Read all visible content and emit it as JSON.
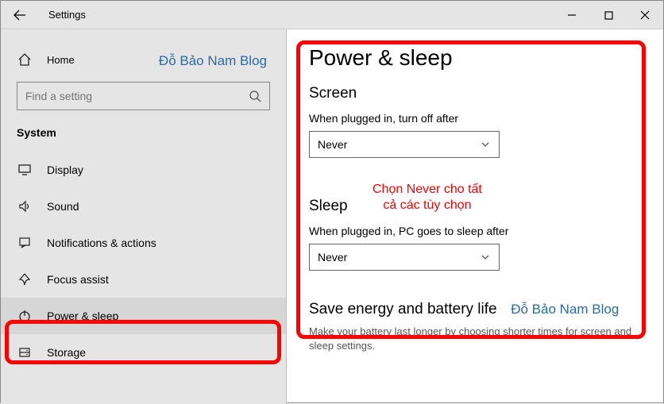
{
  "window": {
    "title": "Settings"
  },
  "brand": "Đỗ Bảo Nam Blog",
  "sidebar": {
    "home_label": "Home",
    "search_placeholder": "Find a setting",
    "section_label": "System",
    "items": [
      {
        "label": "Display"
      },
      {
        "label": "Sound"
      },
      {
        "label": "Notifications & actions"
      },
      {
        "label": "Focus assist"
      },
      {
        "label": "Power & sleep"
      },
      {
        "label": "Storage"
      }
    ]
  },
  "content": {
    "page_title": "Power & sleep",
    "screen": {
      "heading": "Screen",
      "label": "When plugged in, turn off after",
      "value": "Never"
    },
    "sleep": {
      "heading": "Sleep",
      "label": "When plugged in, PC goes to sleep after",
      "value": "Never"
    },
    "footer": {
      "heading": "Save energy and battery life",
      "desc": "Make your battery last longer by choosing shorter times for screen and sleep settings."
    }
  },
  "annotation": {
    "line1": "Chọn Never cho tất",
    "line2": "cả các tùy chọn"
  }
}
